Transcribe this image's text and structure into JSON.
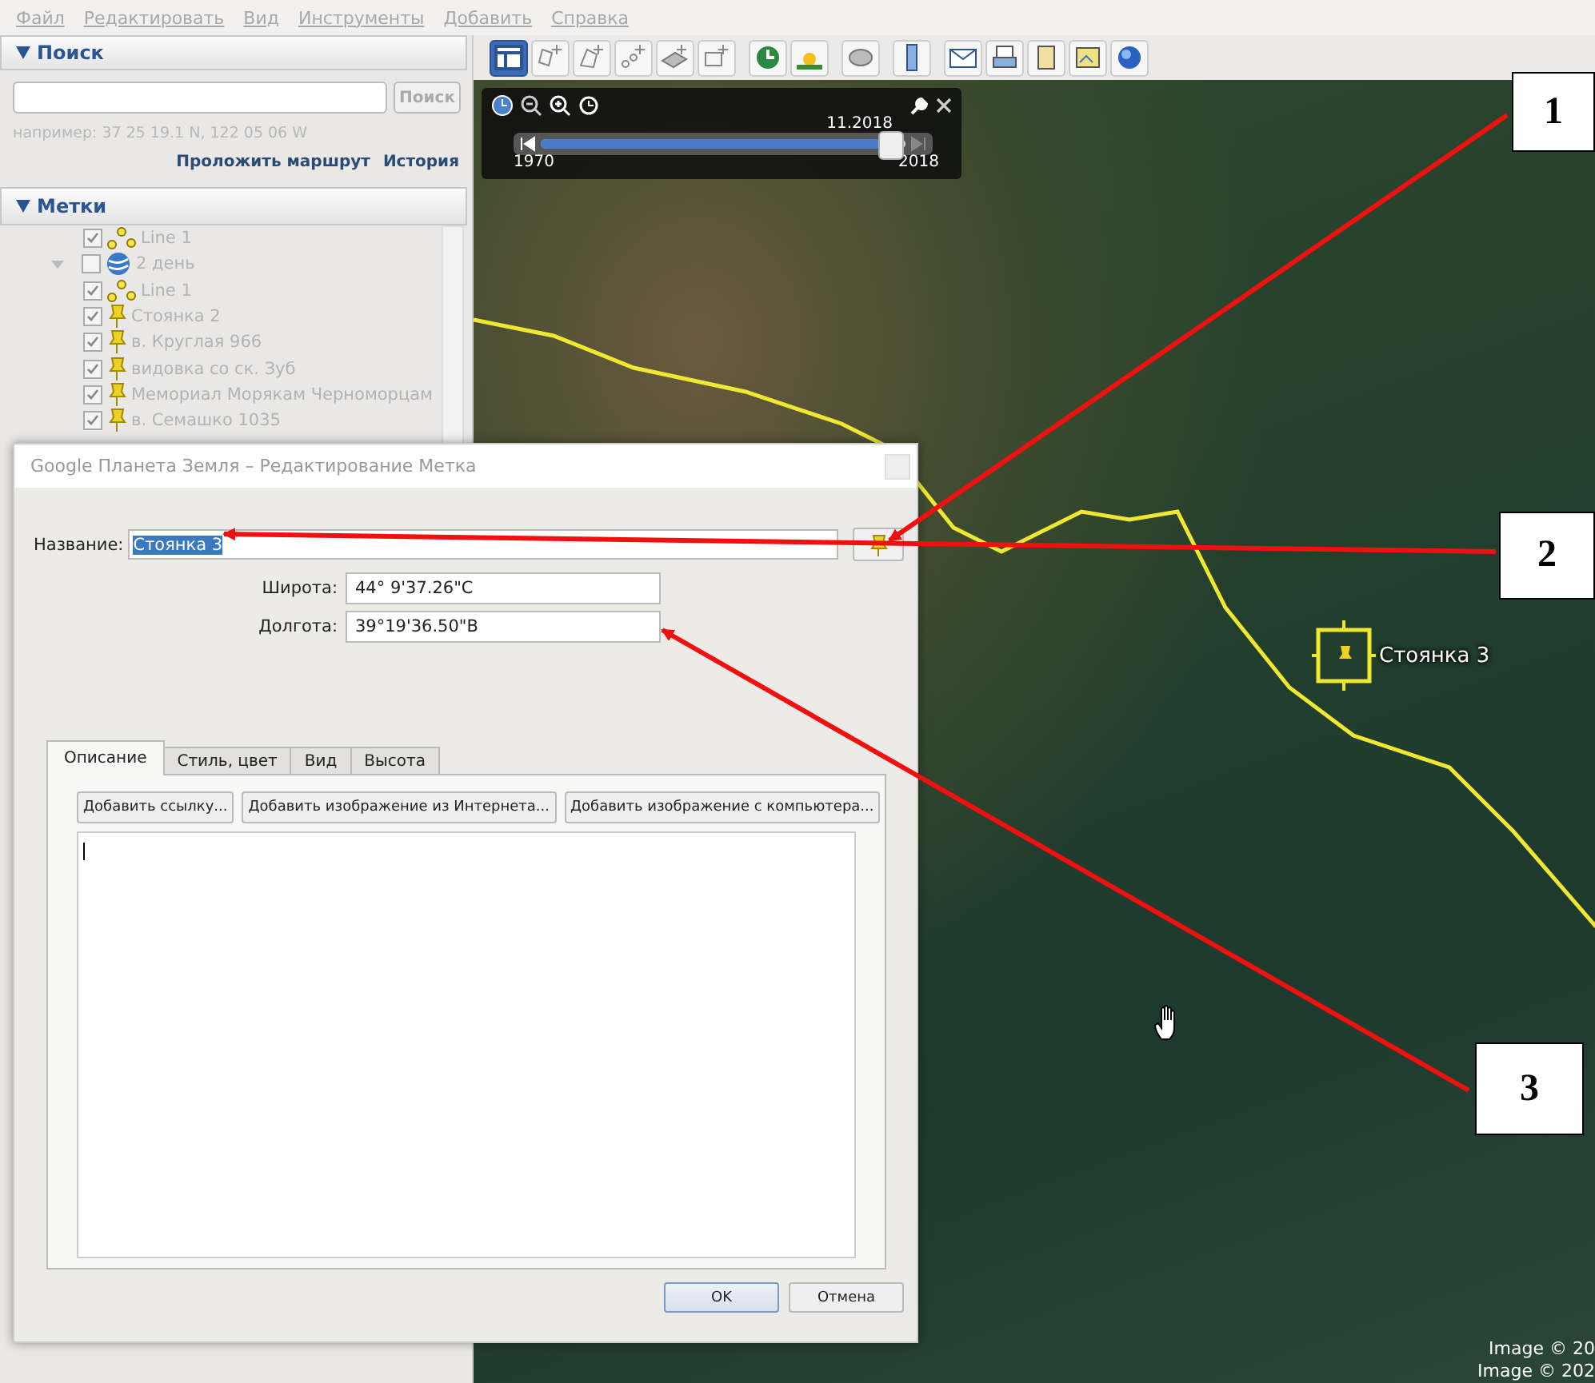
{
  "menu": [
    "Файл",
    "Редактировать",
    "Вид",
    "Инструменты",
    "Добавить",
    "Справка"
  ],
  "search": {
    "title": "Поиск",
    "button": "Поиск",
    "hint": "например: 37 25 19.1 N, 122 05 06 W",
    "links": [
      "Проложить маршрут",
      "История"
    ]
  },
  "places": {
    "title": "Метки",
    "items": [
      {
        "label": "Line 1",
        "kind": "line",
        "checked": true
      },
      {
        "label": "2 день",
        "kind": "folder",
        "checked": false,
        "expanded": true,
        "children": [
          {
            "label": "Line 1",
            "kind": "line",
            "checked": true
          },
          {
            "label": "Стоянка 2",
            "kind": "pin",
            "checked": true
          },
          {
            "label": "в. Круглая 966",
            "kind": "pin",
            "checked": true
          },
          {
            "label": "видовка со ск. Зуб",
            "kind": "pin",
            "checked": true
          },
          {
            "label": "Мемориал Морякам Черноморцам",
            "kind": "pin",
            "checked": true
          },
          {
            "label": "в. Семашко 1035",
            "kind": "pin",
            "checked": true
          }
        ]
      }
    ]
  },
  "time_slider": {
    "date": "11.2018",
    "start": "1970",
    "end": "2018",
    "level": 0.96
  },
  "map": {
    "placemark": "Стоянка 3",
    "credits": [
      "Image © 20",
      "Image © 202"
    ]
  },
  "dialog": {
    "title": "Google Планета Земля – Редактирование Метка",
    "name": {
      "label": "Название:",
      "value": "Стоянка 3",
      "selected": true
    },
    "fields": [
      {
        "label": "Широта:",
        "value": "44° 9'37.26\"С"
      },
      {
        "label": "Долгота:",
        "value": "39°19'36.50\"В"
      }
    ],
    "tabs": [
      {
        "label": "Описание",
        "selected": true
      },
      {
        "label": "Стиль, цвет",
        "selected": false
      },
      {
        "label": "Вид",
        "selected": false
      },
      {
        "label": "Высота",
        "selected": false
      }
    ],
    "tab_buttons": [
      "Добавить ссылку...",
      "Добавить изображение из Интернета...",
      "Добавить изображение с компьютера..."
    ],
    "buttons": [
      "OK",
      "Отмена"
    ]
  },
  "callouts": [
    {
      "label": "1"
    },
    {
      "label": "2"
    },
    {
      "label": "3"
    }
  ]
}
